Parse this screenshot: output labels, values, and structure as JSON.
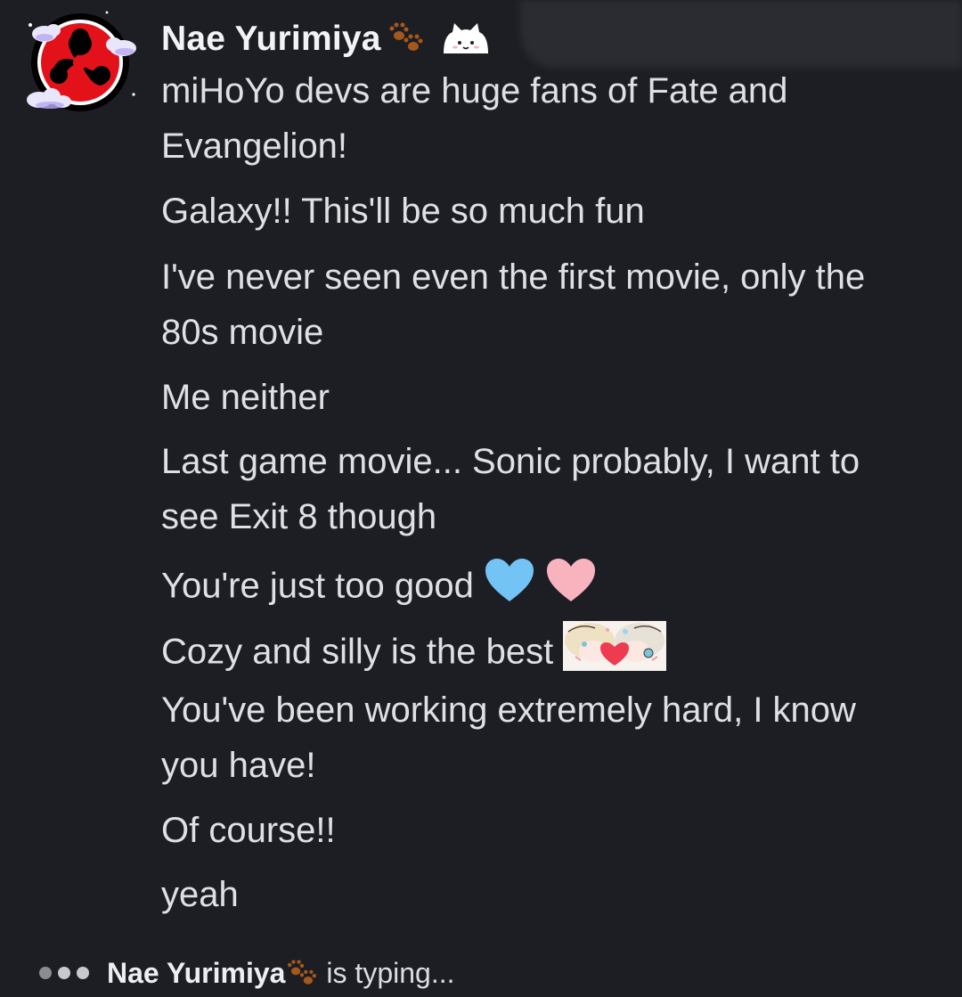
{
  "author": {
    "name": "Nae Yurimiya",
    "avatar_icon": "red-tomoe-emblem-with-clouds",
    "badges": [
      "paw-prints-emoji",
      "white-cat-emoji"
    ]
  },
  "messages": [
    {
      "text": "miHoYo devs are huge fans of Fate and"
    },
    {
      "text": "Evangelion!"
    },
    {
      "text": "Galaxy!! This'll be so much fun"
    },
    {
      "text": "I've never seen even the first movie, only the"
    },
    {
      "text": "80s movie"
    },
    {
      "text": "Me neither"
    },
    {
      "text": "Last game movie... Sonic probably, I want to"
    },
    {
      "text": "see Exit 8 though"
    },
    {
      "text": "You're just too good"
    },
    {
      "text": "Cozy and silly is the best"
    },
    {
      "text": "You've been working extremely hard, I know"
    },
    {
      "text": "you have!"
    },
    {
      "text": "Of course!!"
    },
    {
      "text": "yeah"
    }
  ],
  "inline_emojis": {
    "hearts": [
      "blue-heart",
      "pink-heart"
    ],
    "sticker": "anime-hug-heart-sticker"
  },
  "typing_indicator": {
    "name": "Nae Yurimiya",
    "text": "is typing..."
  },
  "colors": {
    "background": "#1d1e23",
    "text": "#dfe0e4",
    "username": "#f2f3f5",
    "blue_heart": "#74c3f5",
    "pink_heart": "#f8b3bf",
    "avatar_red": "#e3121a"
  }
}
